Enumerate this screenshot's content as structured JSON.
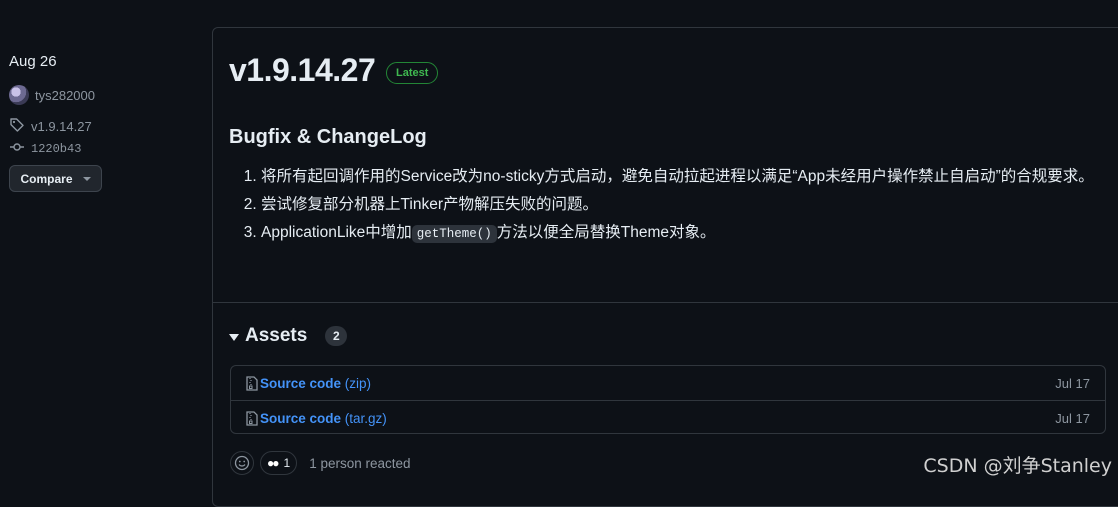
{
  "sidebar": {
    "date": "Aug 26",
    "author": "tys282000",
    "tag": "v1.9.14.27",
    "commit": "1220b43",
    "compare_label": "Compare"
  },
  "release": {
    "title": "v1.9.14.27",
    "badge": "Latest",
    "heading": "Bugfix & ChangeLog",
    "notes": [
      "将所有起回调作用的Service改为no-sticky方式启动，避免自动拉起进程以满足“App未经用户操作禁止自启动”的合规要求。",
      "尝试修复部分机器上Tinker产物解压失败的问题。"
    ],
    "note3": {
      "before": "ApplicationLike中增加",
      "code": "getTheme()",
      "after": "方法以便全局替换Theme对象。"
    }
  },
  "assets": {
    "title": "Assets",
    "count": "2",
    "items": [
      {
        "name": "Source code",
        "ext": "(zip)",
        "date": "Jul 17"
      },
      {
        "name": "Source code",
        "ext": "(tar.gz)",
        "date": "Jul 17"
      }
    ]
  },
  "reactions": {
    "eyes_count": "1",
    "summary": "1 person reacted"
  },
  "watermark": "CSDN @刘争Stanley",
  "colors": {
    "background": "#0d1117",
    "border": "#30363d",
    "link": "#4493f8",
    "latest_green": "#3fb950"
  }
}
